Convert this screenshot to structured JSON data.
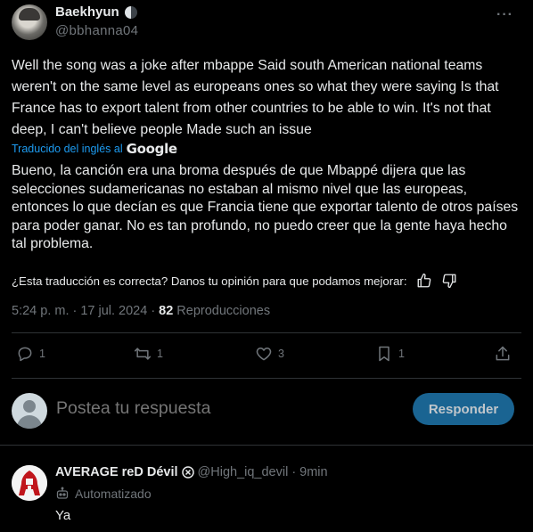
{
  "post": {
    "author_name": "Baekhyun",
    "author_badge_icon": "moon-icon",
    "handle": "@bbhanna04",
    "more_icon": "more-icon",
    "text_original": "Well the song was a joke after mbappe Said south American national teams weren't on the same level as europeans ones so what they were saying Is that France has to export talent from other countries to be able to win. It's not that deep, I can't believe people Made such an issue",
    "translated_by": "Traducido del inglés al",
    "translated_provider": "Google",
    "text_translated": "Bueno, la canción era una broma después de que Mbappé dijera que las selecciones sudamericanas no estaban al mismo nivel que las europeas, entonces lo que decían es que Francia tiene que exportar talento de otros países para poder ganar. No es tan profundo, no puedo creer que la gente haya hecho tal problema.",
    "feedback_question": "¿Esta traducción es correcta? Danos tu opinión para que podamos mejorar:",
    "time": "5:24 p. m.",
    "date": "17 jul. 2024",
    "separator": "·",
    "views_count": "82",
    "views_label": "Reproducciones"
  },
  "actions": {
    "reply_count": "1",
    "repost_count": "1",
    "like_count": "3",
    "bookmark_count": "1"
  },
  "composer": {
    "placeholder": "Postea tu respuesta",
    "button_label": "Responder"
  },
  "reply": {
    "author_name": "AVERAGE reD  Dévil",
    "handle": "@High_iq_devil",
    "separator": "·",
    "time": "9min",
    "automated_label": "Automatizado",
    "text": "Ya"
  }
}
